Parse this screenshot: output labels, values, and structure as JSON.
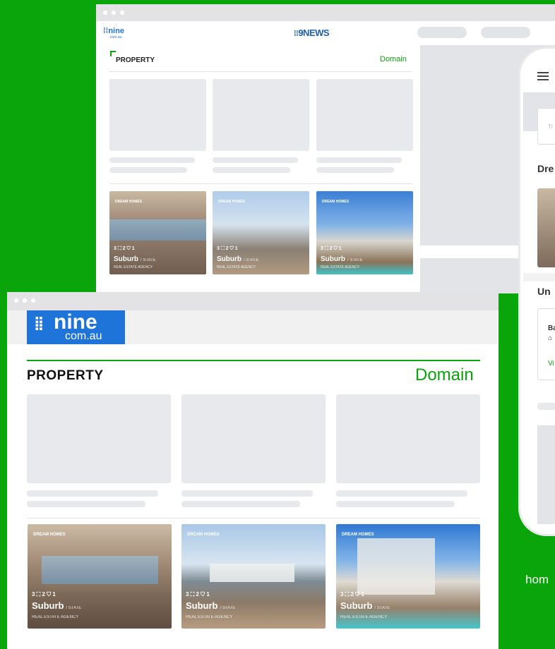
{
  "colors": {
    "brand_green": "#0aa50a",
    "nine_blue": "#1e74d8",
    "skeleton": "#e8e9ec"
  },
  "back_window": {
    "nine_logo": "nine",
    "nine_logo_sub": "com.au",
    "news_logo": "9NEWS",
    "section_title": "PROPERTY",
    "domain_link": "Domain"
  },
  "front_window": {
    "nine_logo": "nine",
    "nine_logo_sub": "com.au",
    "section_title": "PROPERTY",
    "domain_link": "Domain"
  },
  "cards": [
    {
      "tag": "DREAM HOMES",
      "stats": "3 ⛶ 2 ⛉ 1",
      "suburb": "Suburb",
      "state": "/ STATE",
      "agency": "REAL ESTATE AGENCY"
    },
    {
      "tag": "DREAM HOMES",
      "stats": "3 ⛶ 2 ⛉ 1",
      "suburb": "Suburb",
      "state": "/ STATE",
      "agency": "REAL ESTATE AGENCY"
    },
    {
      "tag": "DREAM HOMES",
      "stats": "3 ⛶ 2 ⛉ 1",
      "suburb": "Suburb",
      "state": "/ STATE",
      "agency": "REAL ESTATE AGENCY"
    }
  ],
  "phone": {
    "search_placeholder": "Tr",
    "heading_1": "Dre",
    "heading_2": "Un",
    "listing_label": "Ba",
    "view_link": "Vi"
  },
  "footer_text": "hom"
}
